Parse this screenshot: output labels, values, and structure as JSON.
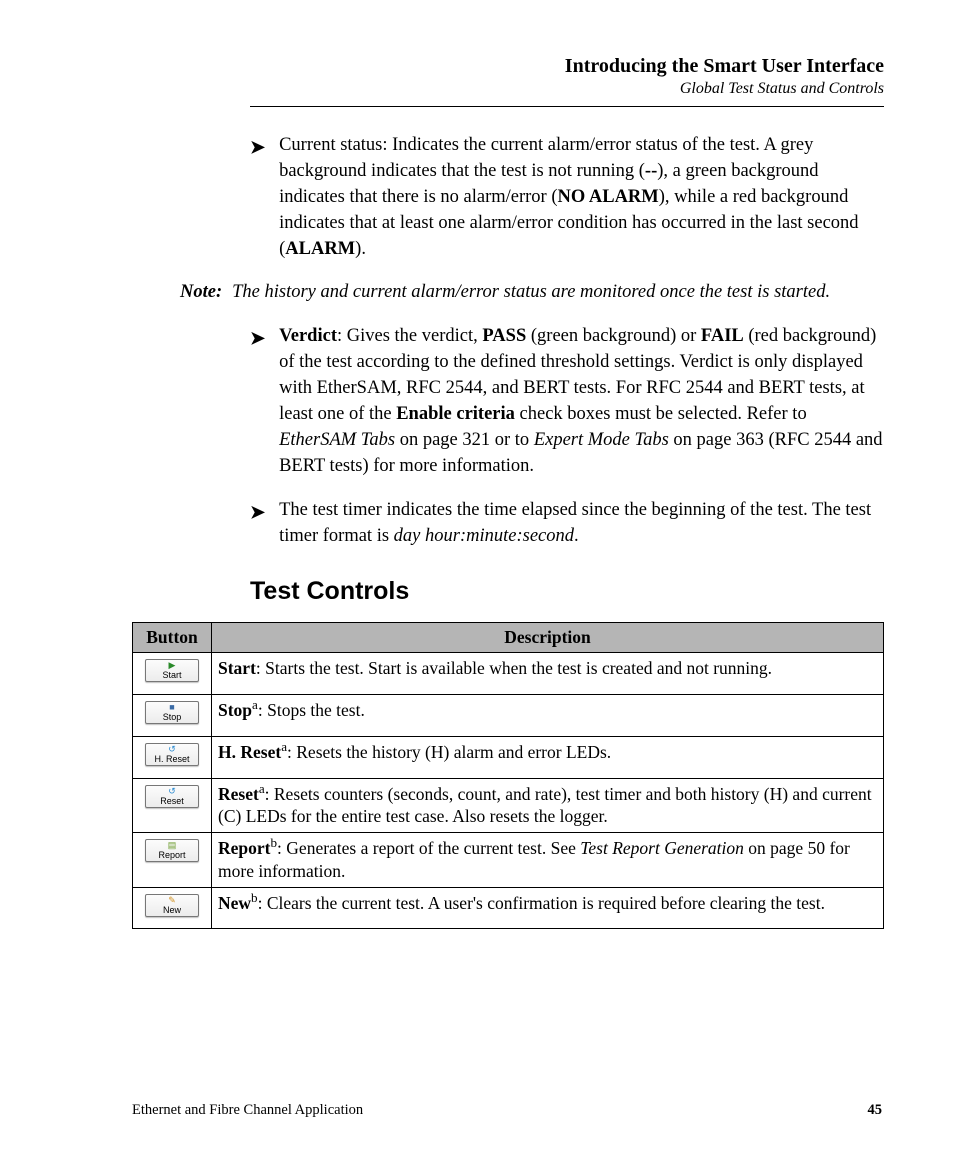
{
  "header": {
    "chapter": "Introducing the Smart User Interface",
    "section": "Global Test Status and Controls"
  },
  "bullets": {
    "b1": {
      "pre": "Current status: Indicates the current alarm/error status of the test. A grey background indicates that the test is not running (",
      "dashes": "--",
      "mid1": "), a green background indicates that there is no alarm/error (",
      "no_alarm": "NO ALARM",
      "mid2": "), while a red background indicates that at least one alarm/error condition has occurred in the last second (",
      "alarm": "ALARM",
      "post": ")."
    },
    "note": {
      "label": "Note:",
      "text": "The history and current alarm/error status are monitored once the test is started."
    },
    "b2": {
      "verdict_label": "Verdict",
      "pre": ": Gives the verdict, ",
      "pass": "PASS",
      "mid1": " (green background) or ",
      "fail": "FAIL",
      "mid2": " (red background) of the test according to the defined threshold settings. Verdict is only displayed with EtherSAM, RFC 2544, and BERT tests. For RFC 2544 and BERT tests, at least one of the ",
      "enable": "Enable criteria",
      "mid3": " check boxes must be selected. Refer to ",
      "ref_tabs": "EtherSAM Tabs",
      "mid4": " on page 321 or to ",
      "ref_em": "Expert Mode Tabs",
      "post": " on page 363 (RFC 2544 and BERT tests) for more information."
    },
    "b3": {
      "pre": "The test timer indicates the time elapsed since the beginning of the test. The test timer format is ",
      "fmt": "day hour:minute:second",
      "post": "."
    }
  },
  "heading": "Test Controls",
  "table": {
    "col_button": "Button",
    "col_desc": "Description",
    "rows": [
      {
        "btn_label": "Start",
        "icon": "▶",
        "name_b": "Start",
        "sup": "",
        "desc": ": Starts the test. Start is available when the test is created and not running."
      },
      {
        "btn_label": "Stop",
        "icon": "■",
        "name_b": "Stop",
        "sup": "a",
        "desc": ": Stops the test."
      },
      {
        "btn_label": "H. Reset",
        "icon": "↺",
        "name_b": "H. Reset",
        "sup": "a",
        "desc": ": Resets the history (H) alarm and error LEDs."
      },
      {
        "btn_label": "Reset",
        "icon": "↺",
        "name_b": "Reset",
        "sup": "a",
        "desc": ": Resets counters (seconds, count, and rate), test timer and both history (H) and current (C) LEDs for the entire test case. Also resets the logger."
      },
      {
        "btn_label": "Report",
        "icon": "▤",
        "name_b": "Report",
        "sup": "b",
        "desc_pre": ": Generates a report of the current test. See ",
        "desc_i": "Test Report Generation",
        "desc_post": " on page 50 for more information."
      },
      {
        "btn_label": "New",
        "icon": "✎",
        "name_b": "New",
        "sup": "b",
        "desc": ": Clears the current test. A user's confirmation is required before clearing the test."
      }
    ]
  },
  "footer": {
    "product": "Ethernet and Fibre Channel Application",
    "page": "45"
  }
}
